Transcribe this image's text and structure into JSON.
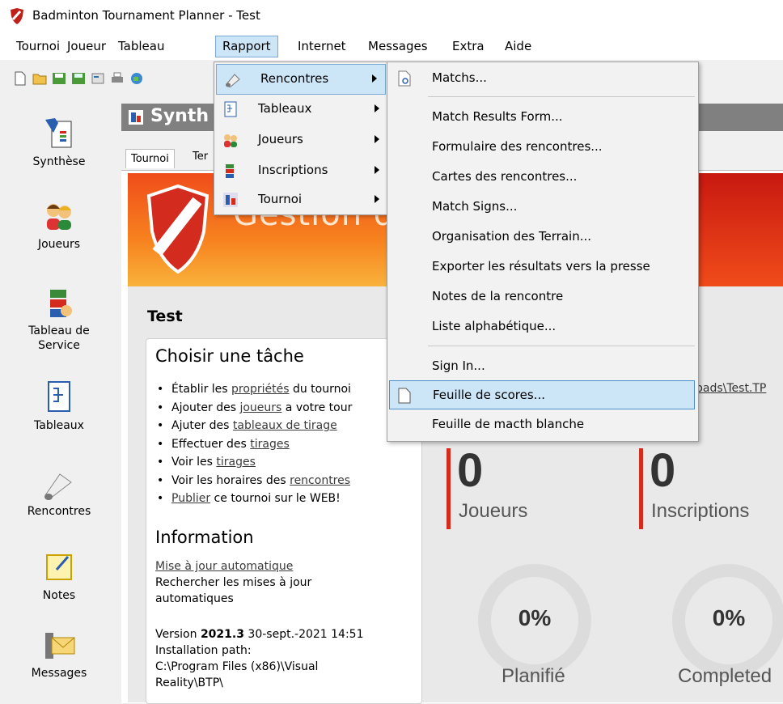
{
  "window": {
    "title": "Badminton Tournament Planner - Test"
  },
  "menubar": [
    "Tournoi",
    "Joueur",
    "Tableau",
    "Rapport",
    "Internet",
    "Messages",
    "Extra",
    "Aide"
  ],
  "sidebar": [
    "Synthèse",
    "Joueurs",
    "Tableau de Service",
    "Tableaux",
    "Rencontres",
    "Notes",
    "Messages"
  ],
  "header": {
    "title": "Synth"
  },
  "tabs": [
    "Tournoi",
    "Ter"
  ],
  "banner": {
    "title": "Gestion de"
  },
  "main": {
    "tournament_name": "Test",
    "task_title": "Choisir une tâche",
    "tasks": [
      {
        "pre": "Établir les ",
        "link": "propriétés",
        "post": " du tournoi"
      },
      {
        "pre": "Ajouter des ",
        "link": "joueurs",
        "post": " a votre tour"
      },
      {
        "pre": "Ajuter des ",
        "link": "tableaux de tirage",
        "post": ""
      },
      {
        "pre": "Effectuer des ",
        "link": "tirages",
        "post": ""
      },
      {
        "pre": "Voir les ",
        "link": "tirages",
        "post": ""
      },
      {
        "pre": "Voir les horaires des ",
        "link": "rencontres",
        "post": ""
      },
      {
        "pre": "",
        "link": "Publier",
        "post": " ce tournoi sur le WEB!"
      }
    ],
    "info_title": "Information",
    "auto_update_link": "Mise à jour automatique",
    "auto_update_text1": "Rechercher les mises à jour",
    "auto_update_text2": "automatiques",
    "version_label": "Version ",
    "version_number": "2021.3",
    "version_date": " 30-sept.-2021 14:51",
    "install_label": "Installation path:",
    "install_path1": "C:\\Program Files (x86)\\Visual",
    "install_path2": "Reality\\BTP\\",
    "file_path_peek": "pads\\Test.TP"
  },
  "stats": [
    {
      "value": "0",
      "label": "Joueurs"
    },
    {
      "value": "0",
      "label": "Inscriptions"
    }
  ],
  "progress": [
    {
      "value": "0%",
      "label": "Planifié",
      "fraction": 0
    },
    {
      "value": "0%",
      "label": "Completed",
      "fraction": 0
    }
  ],
  "rapport_menu": [
    "Rencontres",
    "Tableaux",
    "Joueurs",
    "Inscriptions",
    "Tournoi"
  ],
  "rencontres_submenu": [
    "Matchs...",
    "Match Results Form...",
    "Formulaire des rencontres...",
    "Cartes des rencontres...",
    "Match Signs...",
    "Organisation des Terrain...",
    "Exporter les résultats vers la presse",
    "Notes de la rencontre",
    "Liste alphabétique...",
    "Sign In...",
    "Feuille de scores...",
    "Feuille de macth blanche"
  ],
  "colors": {
    "accent_red": "#d32b1e",
    "highlight": "#cde6f7",
    "banner_orange": "#f04c1a"
  }
}
